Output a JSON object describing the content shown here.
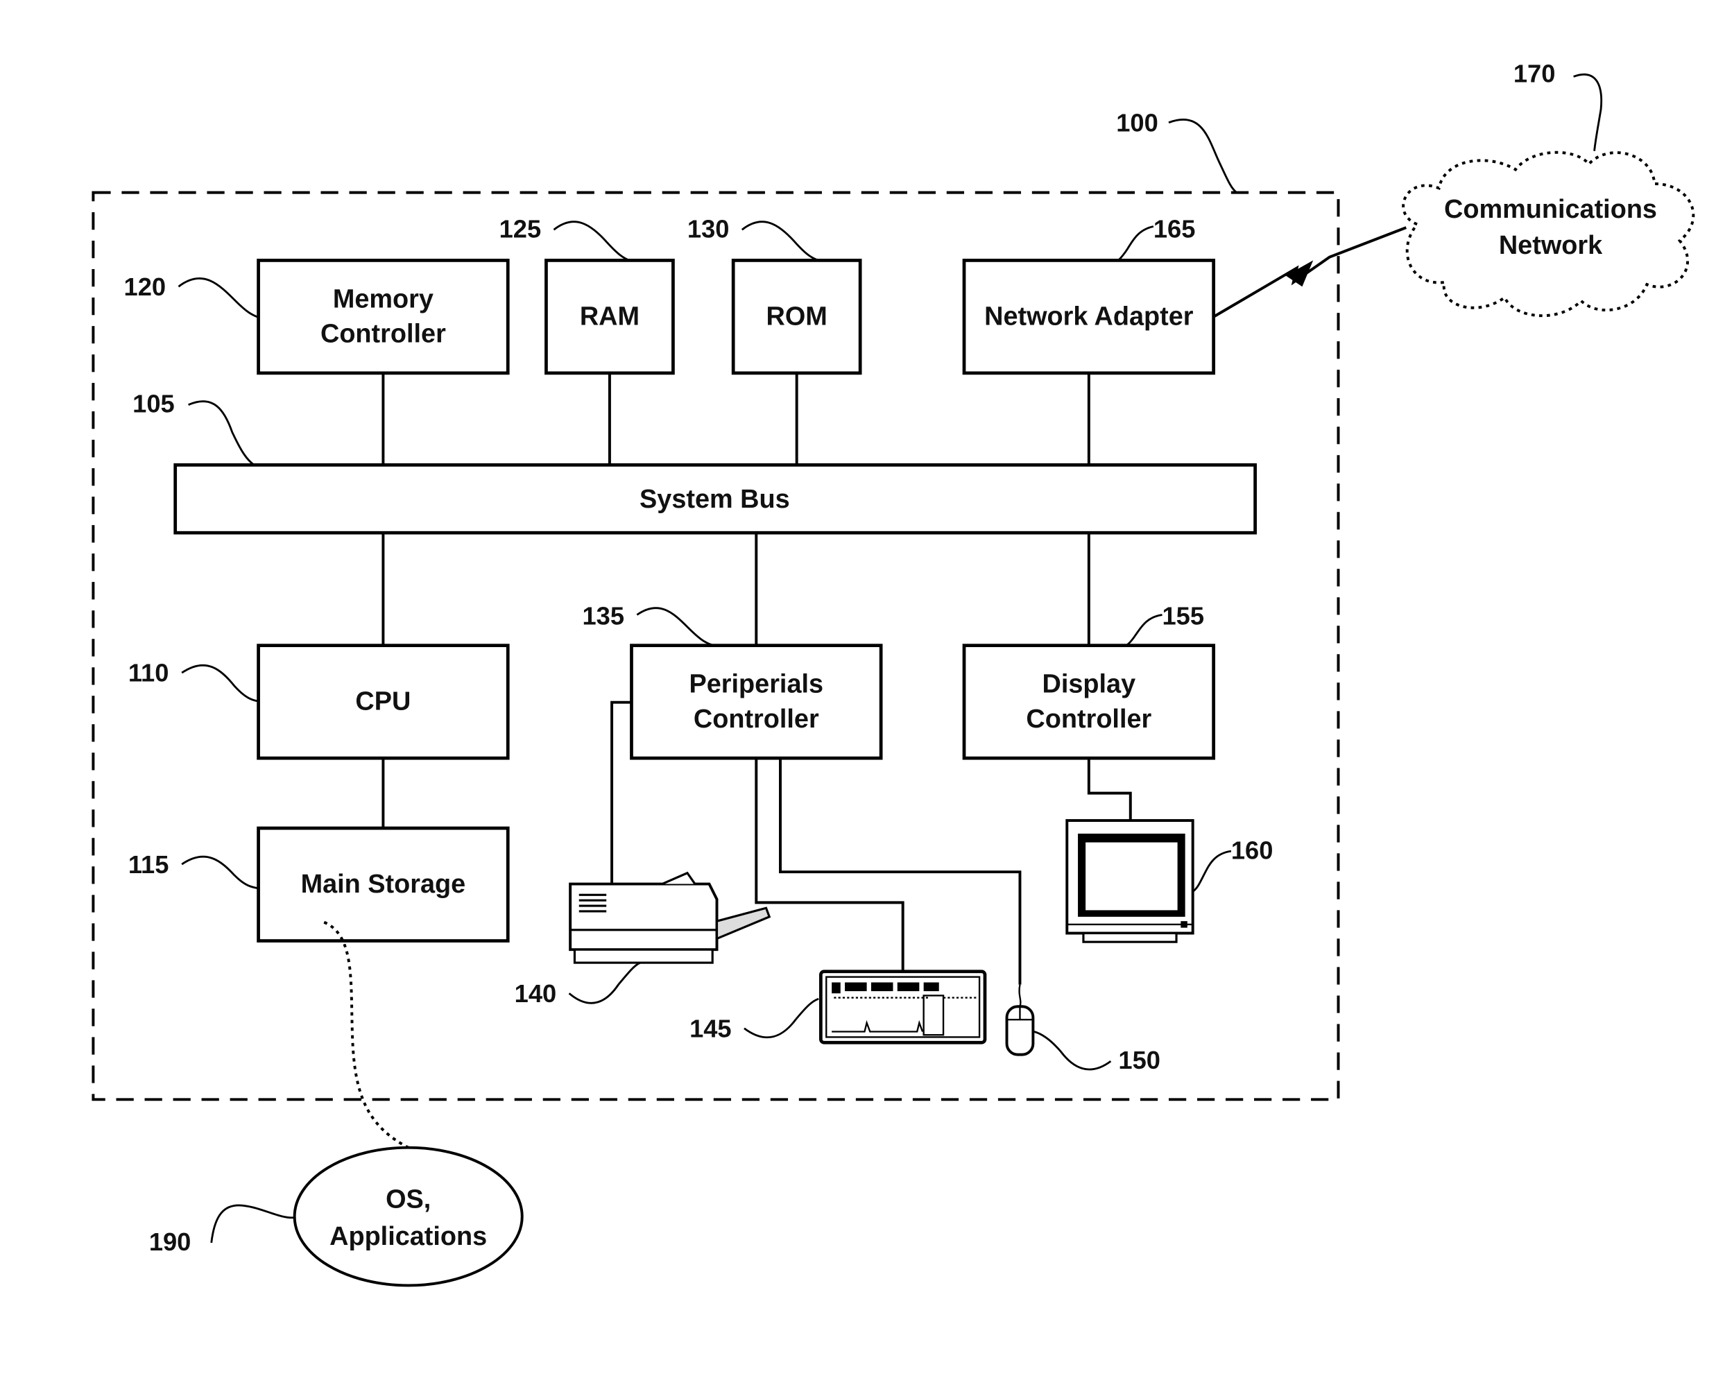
{
  "diagram": {
    "system_ref": "100",
    "bus": {
      "ref": "105",
      "label": "System Bus"
    },
    "blocks": {
      "memory_controller": {
        "ref": "120",
        "lines": [
          "Memory",
          "Controller"
        ]
      },
      "ram": {
        "ref": "125",
        "lines": [
          "RAM"
        ]
      },
      "rom": {
        "ref": "130",
        "lines": [
          "ROM"
        ]
      },
      "network_adapter": {
        "ref": "165",
        "lines": [
          "Network Adapter"
        ]
      },
      "cpu": {
        "ref": "110",
        "lines": [
          "CPU"
        ]
      },
      "main_storage": {
        "ref": "115",
        "lines": [
          "Main Storage"
        ]
      },
      "peripherals_controller": {
        "ref": "135",
        "lines": [
          "Periperials",
          "Controller"
        ]
      },
      "display_controller": {
        "ref": "155",
        "lines": [
          "Display",
          "Controller"
        ]
      }
    },
    "devices": {
      "printer": {
        "ref": "140",
        "icon": "printer-icon"
      },
      "keyboard": {
        "ref": "145",
        "icon": "keyboard-icon"
      },
      "mouse": {
        "ref": "150",
        "icon": "mouse-icon"
      },
      "monitor": {
        "ref": "160",
        "icon": "monitor-icon"
      }
    },
    "network": {
      "ref": "170",
      "lines": [
        "Communications",
        "Network"
      ]
    },
    "software": {
      "ref": "190",
      "lines": [
        "OS,",
        "Applications"
      ]
    }
  }
}
